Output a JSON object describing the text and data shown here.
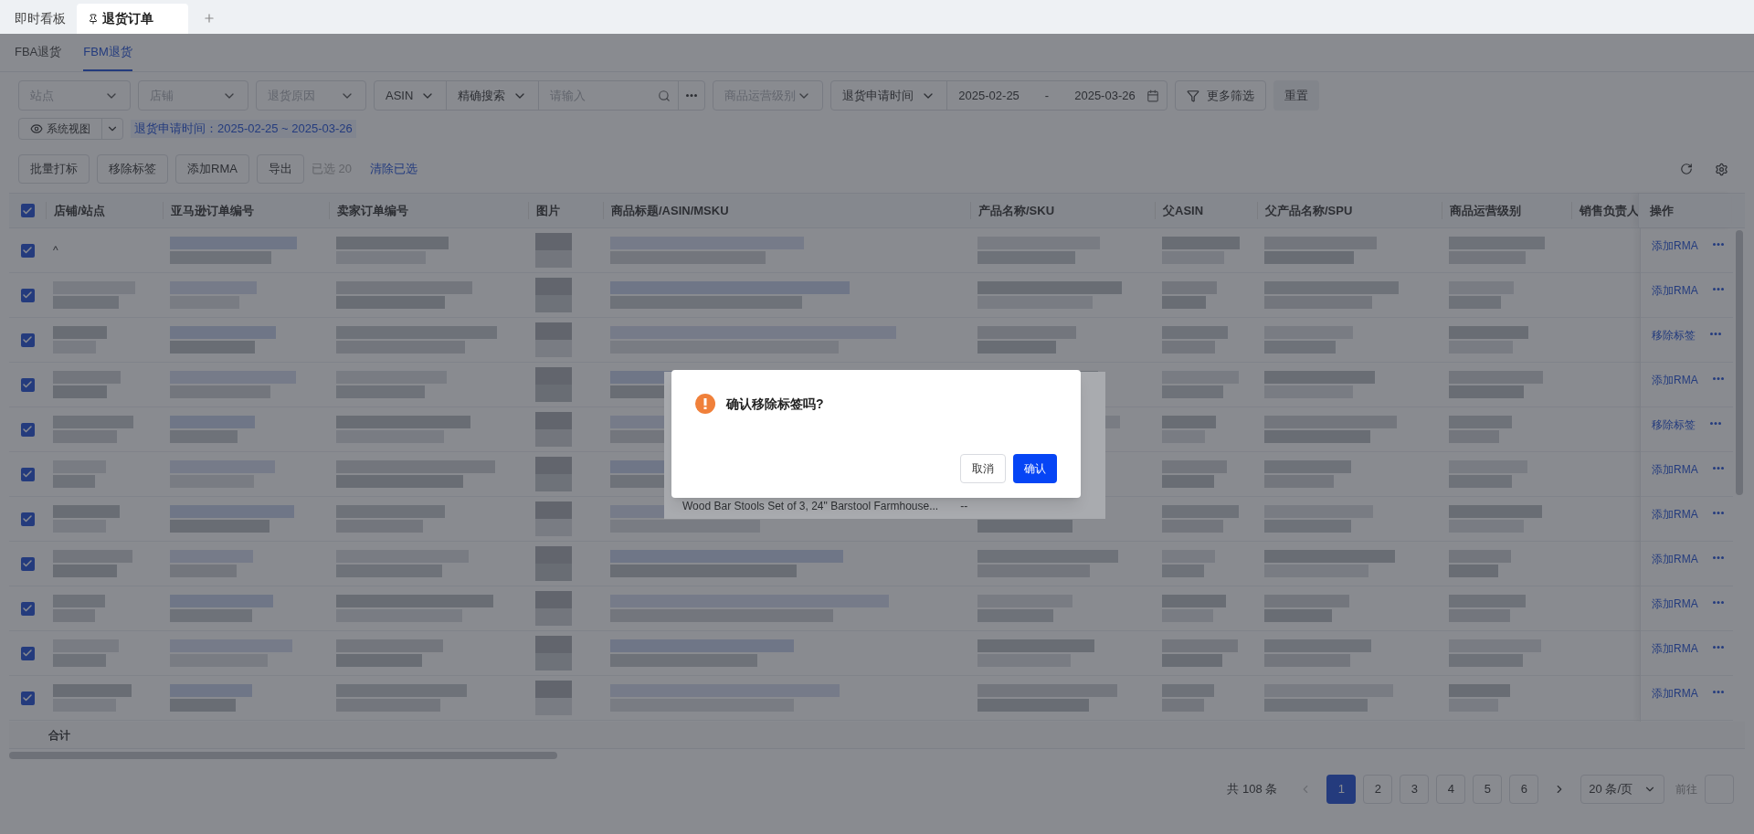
{
  "top_tabs": [
    {
      "label": "即时看板",
      "selected": false,
      "pinned": false
    },
    {
      "label": "退货订单",
      "selected": true,
      "pinned": true
    }
  ],
  "sub_tabs": [
    {
      "label": "FBA退货",
      "selected": false
    },
    {
      "label": "FBM退货",
      "selected": true
    }
  ],
  "filters": {
    "site": {
      "placeholder": "站点"
    },
    "store": {
      "placeholder": "店铺"
    },
    "reason": {
      "placeholder": "退货原因"
    },
    "search_field": "ASIN",
    "search_mode": "精确搜索",
    "search": {
      "placeholder": "请输入"
    },
    "level": {
      "placeholder": "商品运营级别"
    },
    "date_field": "退货申请时间",
    "date_from": "2025-02-25",
    "date_sep": "-",
    "date_to": "2025-03-26",
    "more": "更多筛选",
    "reset": "重置"
  },
  "view": "系统视图",
  "filter_tag": "退货申请时间：2025-02-25 ~ 2025-03-26",
  "toolbar": {
    "buttons": [
      "批量打标",
      "移除标签",
      "添加RMA",
      "导出"
    ],
    "selected_count": "已选 20",
    "clear": "清除已选"
  },
  "table": {
    "columns": [
      "店铺/站点",
      "亚马逊订单编号",
      "卖家订单编号",
      "图片",
      "商品标题/ASIN/MSKU",
      "产品名称/SKU",
      "父ASIN",
      "父产品名称/SPU",
      "商品运营级别",
      "销售负责人",
      "操作"
    ],
    "header_checked": true,
    "rows": [
      {
        "checked": true,
        "store": "^",
        "action": "添加RMA"
      },
      {
        "checked": true,
        "action": "添加RMA"
      },
      {
        "checked": true,
        "action": "移除标签"
      },
      {
        "checked": true,
        "action": "添加RMA"
      },
      {
        "checked": true,
        "action": "移除标签"
      },
      {
        "checked": true,
        "action": "添加RMA"
      },
      {
        "checked": true,
        "action": "添加RMA"
      },
      {
        "checked": true,
        "action": "添加RMA"
      },
      {
        "checked": true,
        "action": "添加RMA"
      },
      {
        "checked": true,
        "action": "添加RMA"
      },
      {
        "checked": true,
        "action": "添加RMA"
      }
    ],
    "summary": "合计"
  },
  "popover": {
    "title": "Wood Bar Stools Set of 3, 24\" Barstool Farmhouse...",
    "value": "--"
  },
  "pagination": {
    "total": "共 108 条",
    "pages": [
      {
        "label": "1",
        "selected": true
      },
      {
        "label": "2",
        "selected": false
      },
      {
        "label": "3",
        "selected": false
      },
      {
        "label": "4",
        "selected": false
      },
      {
        "label": "5",
        "selected": false
      },
      {
        "label": "6",
        "selected": false
      }
    ],
    "page_size": "20 条/页",
    "goto": "前往"
  },
  "dialog": {
    "title": "确认移除标签吗?",
    "cancel": "取消",
    "confirm": "确认"
  }
}
